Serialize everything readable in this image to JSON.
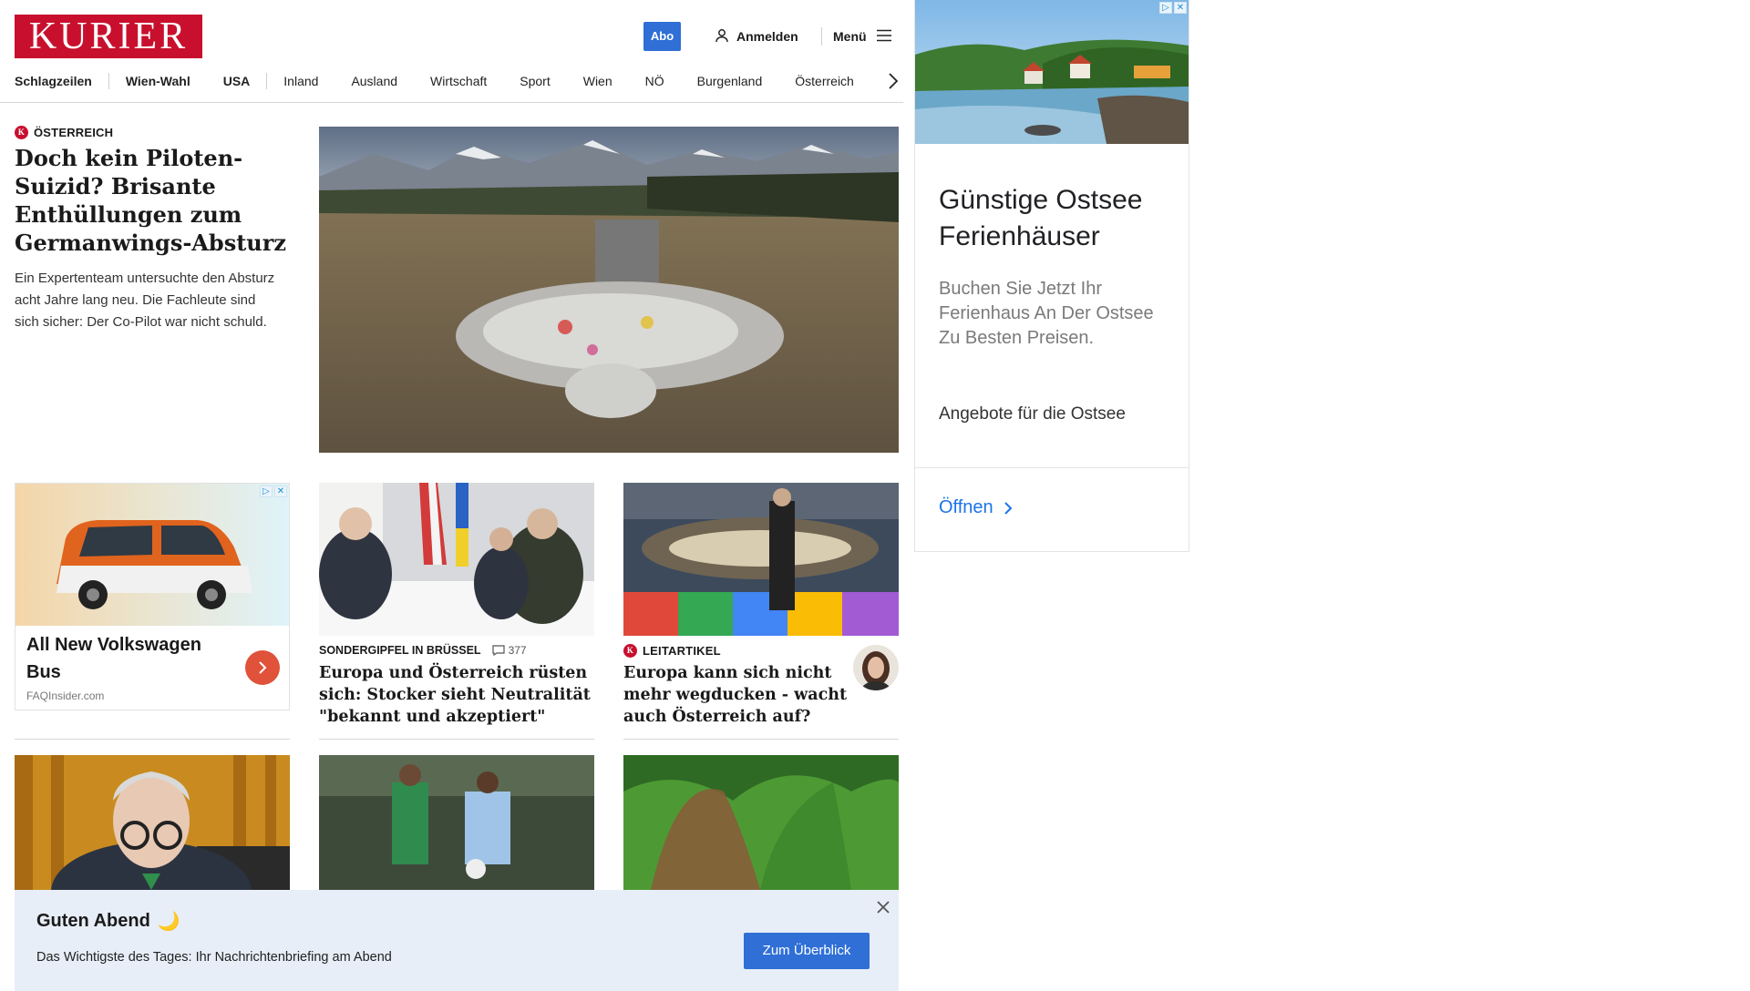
{
  "header": {
    "logo": "KURIER",
    "abo_label": "Abo",
    "login_label": "Anmelden",
    "menu_label": "Menü"
  },
  "nav": {
    "items": [
      {
        "label": "Schlagzeilen"
      },
      {
        "label": "Wien-Wahl"
      },
      {
        "label": "USA"
      },
      {
        "label": "Inland"
      },
      {
        "label": "Ausland"
      },
      {
        "label": "Wirtschaft"
      },
      {
        "label": "Sport"
      },
      {
        "label": "Wien"
      },
      {
        "label": "NÖ"
      },
      {
        "label": "Burgenland"
      },
      {
        "label": "Österreich"
      }
    ]
  },
  "lead": {
    "kicker": "ÖSTERREICH",
    "title": "Doch kein Piloten-Suizid? Brisante Enthüllungen zum Germanwings-Absturz",
    "teaser": "Ein Expertenteam untersuchte den Absturz acht Jahre lang neu. Die Fachleute sind sich sicher: Der Co-Pilot war nicht schuld."
  },
  "ad_vw": {
    "title": "All New Volkswagen Bus",
    "source": "FAQInsider.com"
  },
  "teaser1": {
    "kicker": "SONDERGIPFEL IN BRÜSSEL",
    "comments": "377",
    "title": "Europa und Österreich rüsten sich: Stocker sieht Neutralität \"bekannt und akzeptiert\""
  },
  "teaser2": {
    "kicker": "LEITARTIKEL",
    "title": "Europa kann sich nicht mehr wegducken - wacht auch Österreich auf?"
  },
  "briefing": {
    "title": "Guten Abend",
    "emoji": "🌙",
    "text": "Das Wichtigste des Tages: Ihr Nachrichtenbriefing am Abend",
    "button": "Zum Überblick"
  },
  "ad_ostsee": {
    "title": "Günstige Ostsee Ferienhäuser",
    "text": "Buchen Sie Jetzt Ihr Ferienhaus An Der Ostsee Zu Besten Preisen.",
    "offer": "Angebote für die Ostsee",
    "open": "Öffnen"
  },
  "badge_letter": "K",
  "colors": {
    "brand_red": "#c8102e",
    "accent_blue": "#2f6fd6",
    "briefing_bg": "#e7eef8",
    "ad_link_blue": "#1a73e8"
  }
}
